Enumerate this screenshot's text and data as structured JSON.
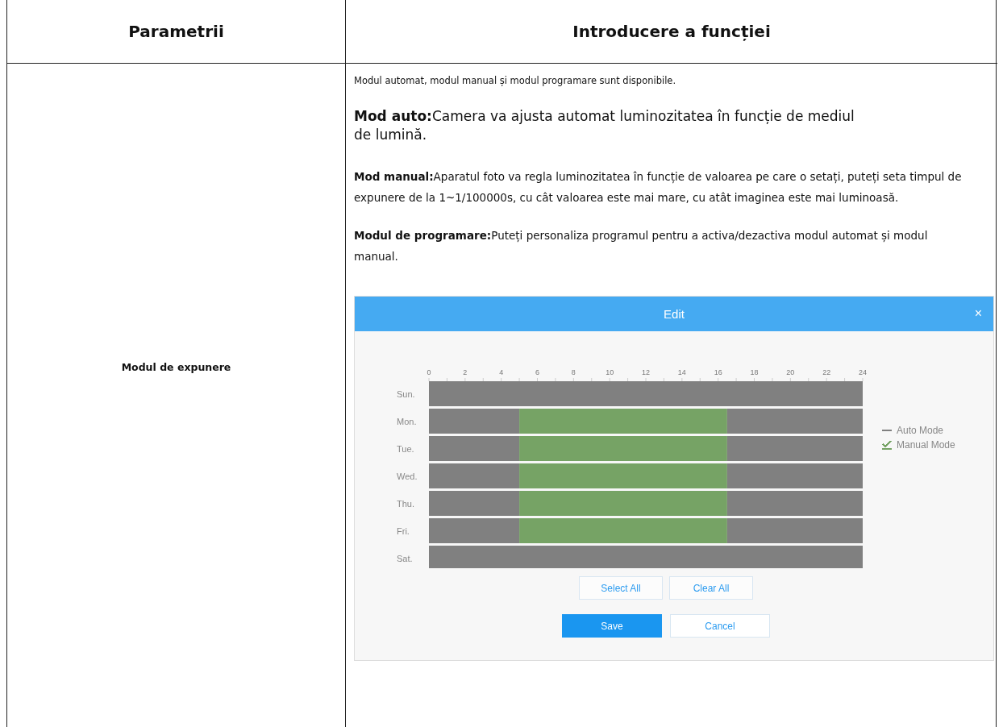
{
  "table": {
    "columns": [
      "Parametrii",
      "Introducere a funcției"
    ],
    "rows": [
      {
        "parameter": "Modul de expunere",
        "paragraphs": [
          {
            "kind": "small",
            "text": "Modul automat, modul manual și modul programare sunt disponibile."
          },
          {
            "kind": "large",
            "text": "**Mod auto:**Camera va ajusta automat luminozitatea în funcție de mediul de lumină."
          },
          {
            "kind": "normal",
            "text": "**Mod manual:**Aparatul foto va regla luminozitatea în funcție de valoarea pe care o setați, puteți seta timpul de expunere de la 1~1/100000s, cu cât valoarea este mai mare, cu atât imaginea este mai luminoasă."
          },
          {
            "kind": "normal",
            "text": "**Modul de programare:**Puteți personaliza programul pentru a activa/dezactiva modul automat și modul manual."
          }
        ],
        "dialog": {
          "title": "Edit",
          "close": "×",
          "chart_data": {
            "type": "bar",
            "orientation": "horizontal",
            "stacked": true,
            "categories": [
              "Sun.",
              "Mon.",
              "Tue.",
              "Wed.",
              "Thu.",
              "Fri.",
              "Sat."
            ],
            "series": [
              {
                "name": "Auto Mode",
                "marker": "dash",
                "color": "#808080",
                "values": [
                  24,
                  5,
                  5,
                  5,
                  5,
                  5,
                  24
                ]
              },
              {
                "name": "Manual Mode",
                "marker": "check",
                "color": "#76a365",
                "values": [
                  0,
                  11.5,
                  11.5,
                  11.5,
                  11.5,
                  11.5,
                  0
                ]
              },
              {
                "color": "#808080",
                "values": [
                  0,
                  7.5,
                  7.5,
                  7.5,
                  7.5,
                  7.5,
                  0
                ]
              }
            ],
            "xlim": [
              0,
              24
            ],
            "xticks": [
              0,
              2,
              4,
              6,
              8,
              10,
              12,
              14,
              16,
              18,
              20,
              22,
              24
            ]
          },
          "buttons": [
            {
              "kind": "secondary",
              "label": "Select All"
            },
            {
              "kind": "secondary",
              "label": "Clear All"
            },
            {
              "kind": "primary",
              "label": "Save"
            },
            {
              "kind": "outline",
              "label": "Cancel"
            }
          ]
        }
      }
    ]
  }
}
